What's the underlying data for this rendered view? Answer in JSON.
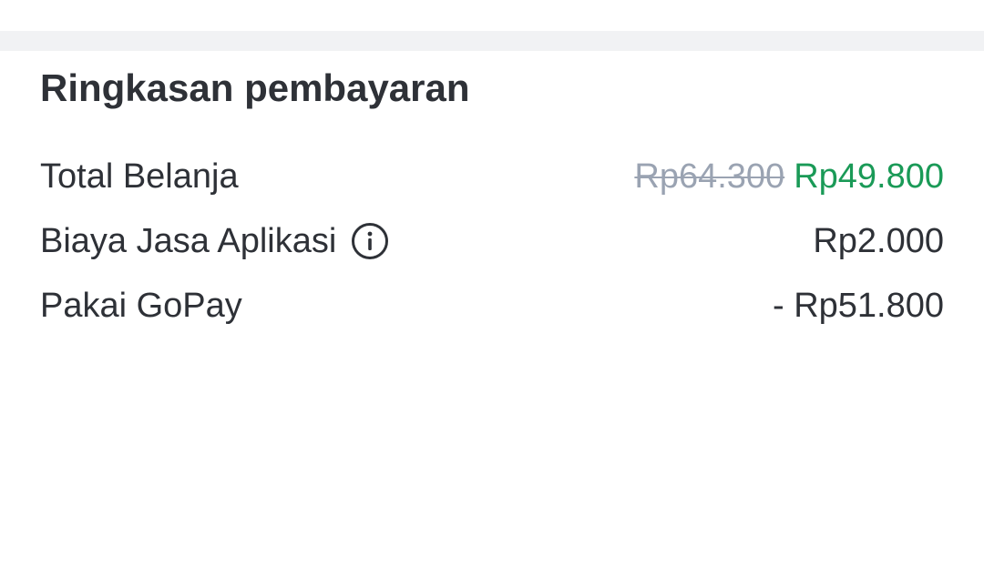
{
  "summary": {
    "title": "Ringkasan pembayaran",
    "total_belanja": {
      "label": "Total Belanja",
      "original_price": "Rp64.300",
      "discounted_price": "Rp49.800"
    },
    "biaya_jasa": {
      "label": "Biaya Jasa Aplikasi",
      "value": "Rp2.000",
      "icon": "info-icon"
    },
    "gopay": {
      "label": "Pakai GoPay",
      "value": "- Rp51.800"
    }
  },
  "colors": {
    "text": "#2e3137",
    "strikethrough": "#9aa3b2",
    "discount": "#1a9a57",
    "divider_band": "#f1f2f4"
  }
}
